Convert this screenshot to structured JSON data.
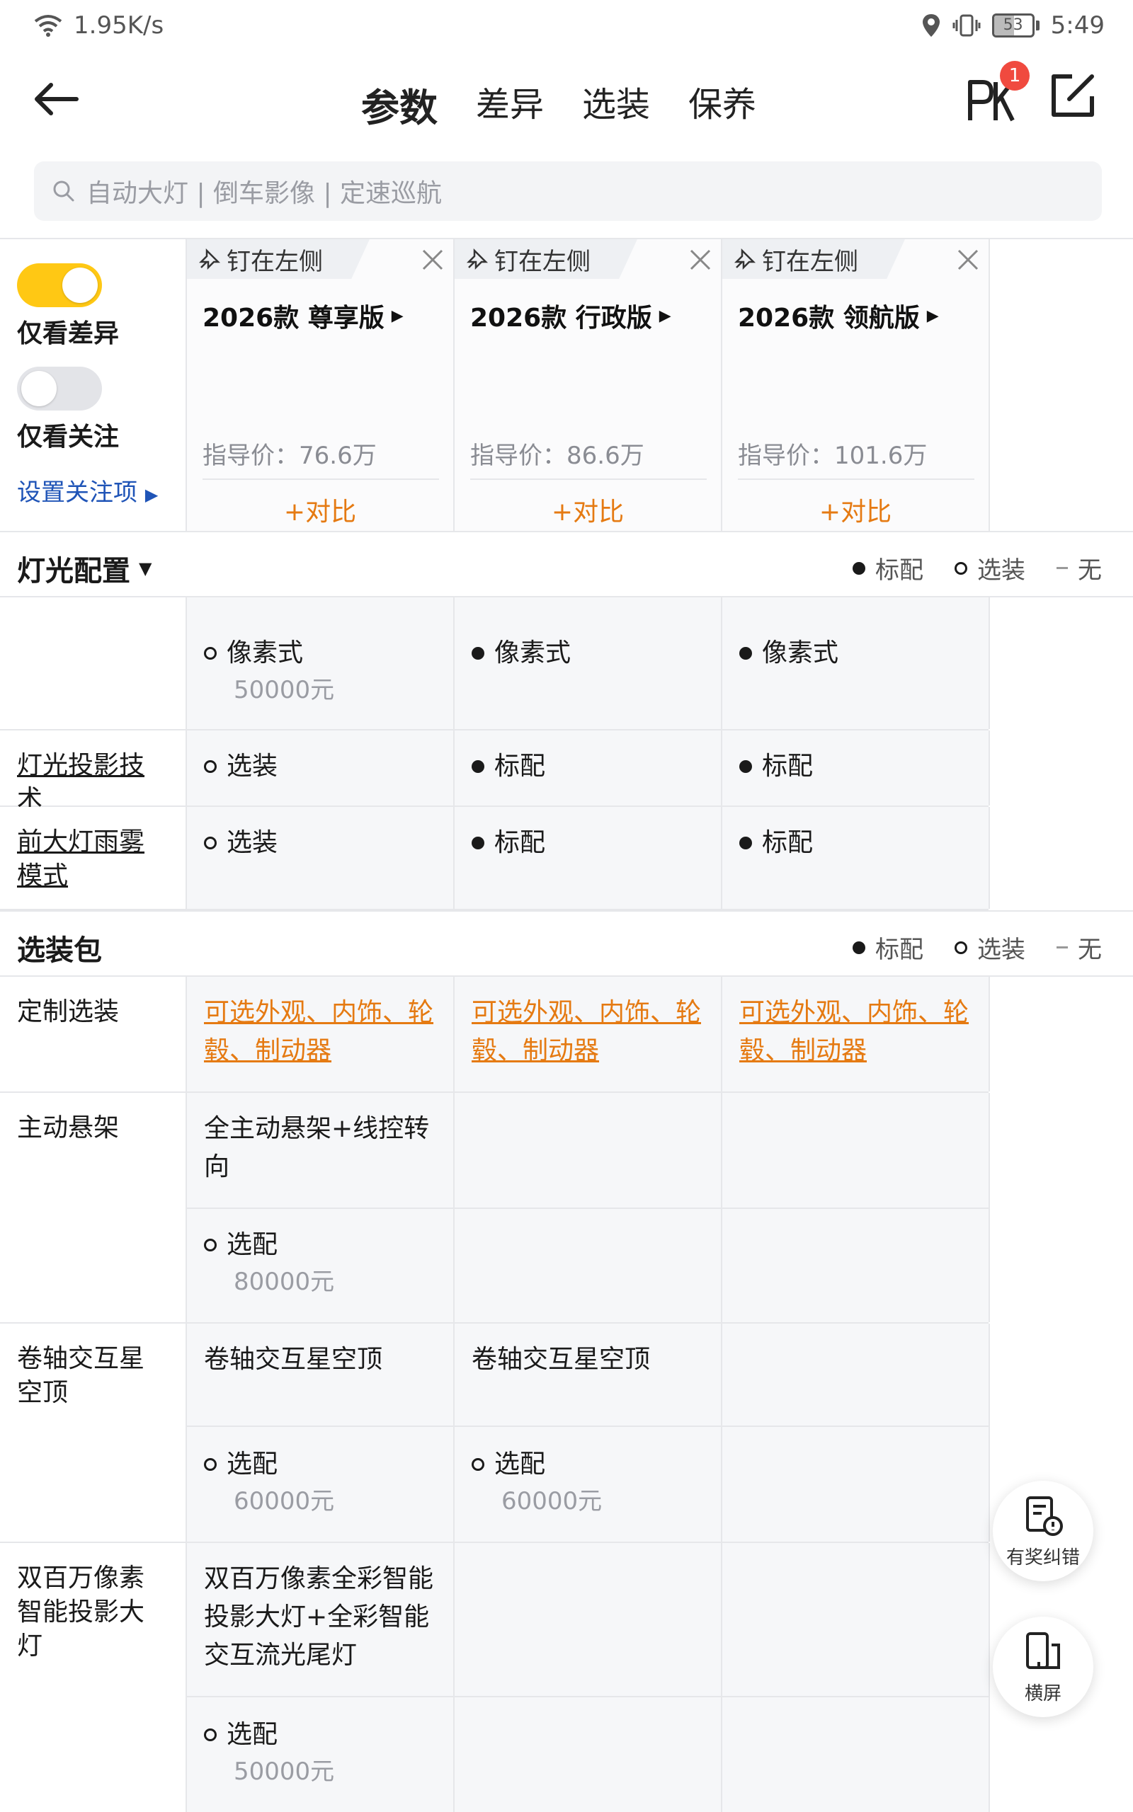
{
  "status": {
    "speed": "1.95K/s",
    "battery": "53",
    "time": "5:49"
  },
  "header": {
    "tabs": [
      "参数",
      "差异",
      "选装",
      "保养"
    ],
    "active_tab": 0,
    "pk_label": "PK",
    "pk_badge": "1"
  },
  "search": {
    "placeholder": "自动大灯 | 倒车影像 | 定速巡航"
  },
  "filters": {
    "diff_label": "仅看差异",
    "diff_on": true,
    "focus_label": "仅看关注",
    "focus_on": false,
    "set_focus_link": "设置关注项"
  },
  "cars": [
    {
      "pin": "钉在左侧",
      "name": "2026款 尊享版",
      "price": "指导价：76.6万",
      "compare": "+对比"
    },
    {
      "pin": "钉在左侧",
      "name": "2026款 行政版",
      "price": "指导价：86.6万",
      "compare": "+对比"
    },
    {
      "pin": "钉在左侧",
      "name": "2026款 领航版",
      "price": "指导价：101.6万",
      "compare": "+对比"
    }
  ],
  "legend": {
    "standard": "标配",
    "optional": "选装",
    "none": "无"
  },
  "sections": {
    "lighting": {
      "title": "灯光配置",
      "rows": [
        {
          "label": "",
          "cells": [
            {
              "type": "optional",
              "text": "像素式",
              "sub": "50000元"
            },
            {
              "type": "standard",
              "text": "像素式"
            },
            {
              "type": "standard",
              "text": "像素式"
            }
          ]
        },
        {
          "label": "灯光投影技术",
          "cells": [
            {
              "type": "optional",
              "text": "选装"
            },
            {
              "type": "standard",
              "text": "标配"
            },
            {
              "type": "standard",
              "text": "标配"
            }
          ]
        },
        {
          "label": "前大灯雨雾模式",
          "cells": [
            {
              "type": "optional",
              "text": "选装"
            },
            {
              "type": "standard",
              "text": "标配"
            },
            {
              "type": "standard",
              "text": "标配"
            }
          ]
        }
      ]
    },
    "packages": {
      "title": "选装包",
      "rows": [
        {
          "label": "定制选装",
          "cells": [
            "可选外观、内饰、轮毂、制动器",
            "可选外观、内饰、轮毂、制动器",
            "可选外观、内饰、轮毂、制动器"
          ]
        },
        {
          "label": "主动悬架",
          "c1_name": "全主动悬架+线控转向",
          "c1_opt": "选配",
          "c1_price": "80000元"
        },
        {
          "label": "卷轴交互星空顶",
          "c1_name": "卷轴交互星空顶",
          "c1_opt": "选配",
          "c1_price": "60000元",
          "c2_name": "卷轴交互星空顶",
          "c2_opt": "选配",
          "c2_price": "60000元"
        },
        {
          "label": "双百万像素智能投影大灯",
          "c1_name": "双百万像素全彩智能投影大灯+全彩智能交互流光尾灯",
          "c1_opt": "选配",
          "c1_price": "50000元"
        }
      ]
    }
  },
  "floating": {
    "feedback": "有奖纠错",
    "landscape": "横屏"
  },
  "colors": {
    "accent": "#ffc814",
    "link_orange": "#e57a12",
    "link_blue": "#1f54b7",
    "badge_red": "#f04a3f"
  }
}
